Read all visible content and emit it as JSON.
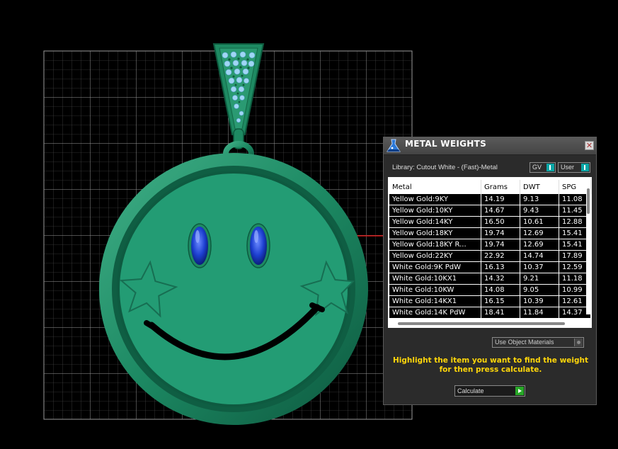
{
  "viewport": {
    "description_icons": [
      "smiley-pendant-model"
    ],
    "colors": {
      "background": "#000000",
      "grid": "#8c8c8c",
      "pendant": "#1f8a66",
      "eyes": "#1a3ccf",
      "axis": "#cc1111"
    }
  },
  "panel": {
    "title": "METAL WEIGHTS",
    "library_label": "Library: Cutout White - (Fast)-Metal",
    "toggle_gv": "GV",
    "toggle_user": "User",
    "columns": [
      "Metal",
      "Grams",
      "DWT",
      "SPG"
    ],
    "rows": [
      [
        "Yellow Gold:9KY",
        "14.19",
        "9.13",
        "11.08"
      ],
      [
        "Yellow Gold:10KY",
        "14.67",
        "9.43",
        "11.45"
      ],
      [
        "Yellow Gold:14KY",
        "16.50",
        "10.61",
        "12.88"
      ],
      [
        "Yellow Gold:18KY",
        "19.74",
        "12.69",
        "15.41"
      ],
      [
        "Yellow Gold:18KY R...",
        "19.74",
        "12.69",
        "15.41"
      ],
      [
        "Yellow Gold:22KY",
        "22.92",
        "14.74",
        "17.89"
      ],
      [
        "White Gold:9K PdW",
        "16.13",
        "10.37",
        "12.59"
      ],
      [
        "White Gold:10KX1",
        "14.32",
        "9.21",
        "11.18"
      ],
      [
        "White Gold:10KW",
        "14.08",
        "9.05",
        "10.99"
      ],
      [
        "White Gold:14KX1",
        "16.15",
        "10.39",
        "12.61"
      ],
      [
        "White Gold:14K PdW",
        "18.41",
        "11.84",
        "14.37"
      ]
    ],
    "material_option": "Use Object Materials",
    "hint_text": "Highlight the item you want to find the weight for then press calculate.",
    "calculate_label": "Calculate",
    "close_glyph": "✕"
  }
}
